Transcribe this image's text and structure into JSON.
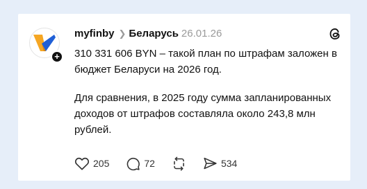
{
  "post": {
    "username": "myfinby",
    "community": "Беларусь",
    "date": "26.01.26",
    "paragraph1": "310 331 606 BYN – такой план по штрафам заложен в бюджет Беларуси на 2026 год.",
    "paragraph2": "Для сравнения, в 2025 году сумма запланированных доходов от штрафов составляла около 243,8 млн рублей.",
    "likes": "205",
    "replies": "72",
    "shares": "534"
  },
  "icons": {
    "avatar": "myfinby-logo",
    "follow": "plus-icon",
    "separator": "chevron-right-icon",
    "platform": "threads-icon",
    "like": "heart-icon",
    "reply": "comment-icon",
    "repost": "repost-icon",
    "share": "send-icon"
  },
  "colors": {
    "background": "#e6eef9",
    "card": "#ffffff",
    "text": "#111111",
    "muted": "#9a9a9a",
    "logo_orange": "#f5a623",
    "logo_blue": "#1f5fd6"
  }
}
